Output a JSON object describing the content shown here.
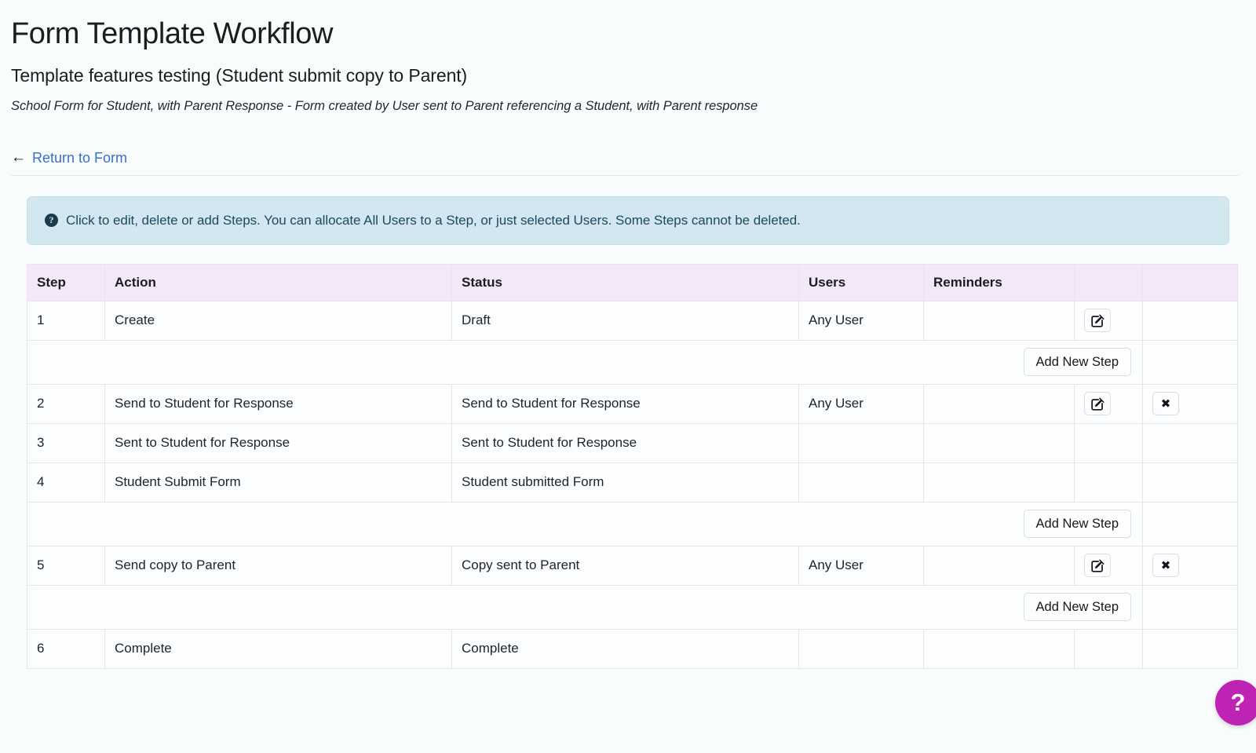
{
  "header": {
    "title": "Form Template Workflow",
    "subtitle": "Template features testing (Student submit copy to Parent)",
    "description": "School Form for Student, with Parent Response - Form created by User sent to Parent referencing a Student, with Parent response"
  },
  "nav": {
    "return_link_label": "Return to Form",
    "return_arrow": "←"
  },
  "banner": {
    "icon": "help-circle-icon",
    "glyph": "?",
    "text": "Click to edit, delete or add Steps. You can allocate All Users to a Step, or just selected Users. Some Steps cannot be deleted."
  },
  "table": {
    "columns": [
      "Step",
      "Action",
      "Status",
      "Users",
      "Reminders",
      "",
      ""
    ],
    "add_step_label": "Add New Step",
    "rows": [
      {
        "kind": "step",
        "step": "1",
        "action": "Create",
        "status": "Draft",
        "users": "Any User",
        "reminders": "",
        "has_edit": true,
        "has_delete": false
      },
      {
        "kind": "add"
      },
      {
        "kind": "step",
        "step": "2",
        "action": "Send to Student for Response",
        "status": "Send to Student for Response",
        "users": "Any User",
        "reminders": "",
        "has_edit": true,
        "has_delete": true
      },
      {
        "kind": "step",
        "step": "3",
        "action": "Sent to Student for Response",
        "status": "Sent to Student for Response",
        "users": "",
        "reminders": "",
        "has_edit": false,
        "has_delete": false
      },
      {
        "kind": "step",
        "step": "4",
        "action": "Student Submit Form",
        "status": "Student submitted Form",
        "users": "",
        "reminders": "",
        "has_edit": false,
        "has_delete": false
      },
      {
        "kind": "add"
      },
      {
        "kind": "step",
        "step": "5",
        "action": "Send copy to Parent",
        "status": "Copy sent to Parent",
        "users": "Any User",
        "reminders": "",
        "has_edit": true,
        "has_delete": true
      },
      {
        "kind": "add"
      },
      {
        "kind": "step",
        "step": "6",
        "action": "Complete",
        "status": "Complete",
        "users": "",
        "reminders": "",
        "has_edit": false,
        "has_delete": false
      }
    ]
  },
  "help_fab": {
    "label": "?",
    "color": "#bf23b4"
  },
  "icons": {
    "edit": "edit-square-pencil-icon",
    "delete": "close-x-icon"
  },
  "colors": {
    "page_background": "#f9fcfd",
    "table_header_background": "#f3e8fa",
    "banner_background": "#d3e7f1",
    "link": "#3b6fc4",
    "fab": "#bf23b4"
  }
}
